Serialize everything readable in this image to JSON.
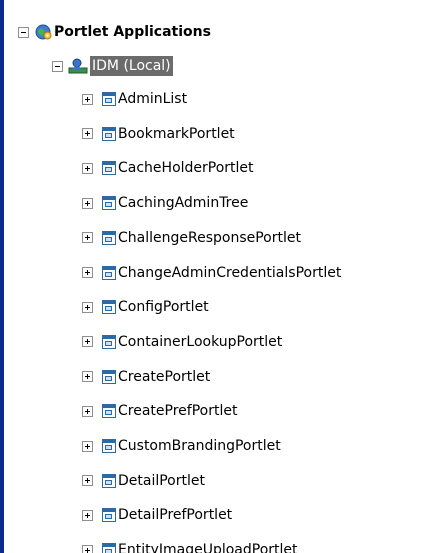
{
  "tree": {
    "root": {
      "label": "Portlet Applications",
      "icon": "globe-gear-icon",
      "expanded": true
    },
    "server": {
      "label": "IDM (Local)",
      "icon": "server-user-icon",
      "expanded": true,
      "selected": true
    },
    "portlets": [
      "AdminList",
      "BookmarkPortlet",
      "CacheHolderPortlet",
      "CachingAdminTree",
      "ChallengeResponsePortlet",
      "ChangeAdminCredentialsPortlet",
      "ConfigPortlet",
      "ContainerLookupPortlet",
      "CreatePortlet",
      "CreatePrefPortlet",
      "CustomBrandingPortlet",
      "DetailPortlet",
      "DetailPrefPortlet",
      "EntityImageUploadPortlet"
    ],
    "portlet_icon": "portlet-window-icon"
  }
}
